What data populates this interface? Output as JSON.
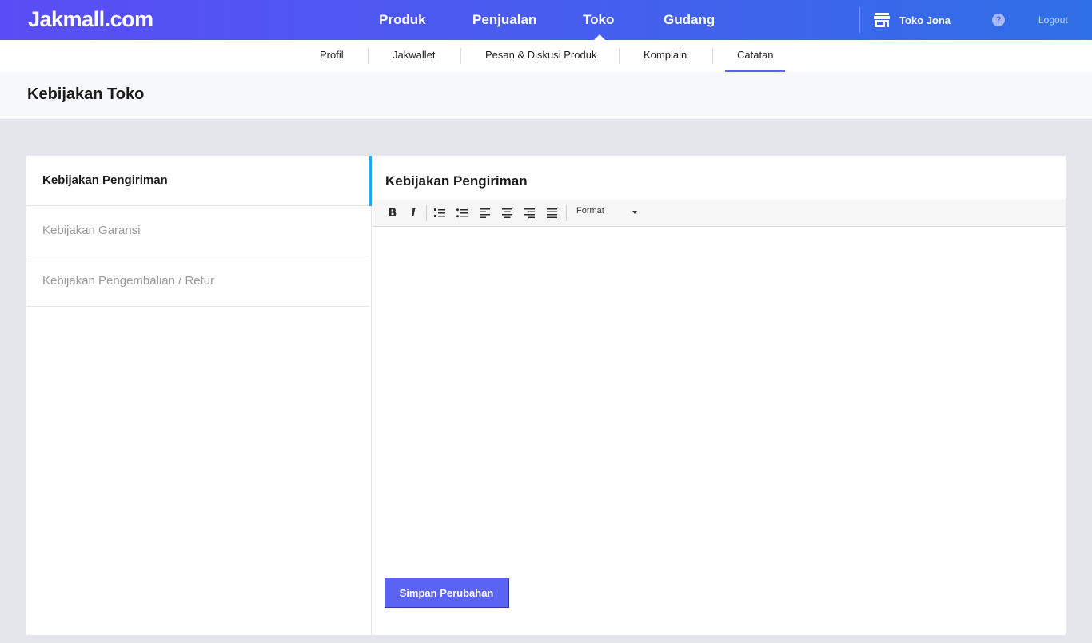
{
  "app": {
    "logo": "Jakmall.com"
  },
  "topnav": {
    "items": [
      {
        "label": "Produk"
      },
      {
        "label": "Penjualan"
      },
      {
        "label": "Toko",
        "active": true
      },
      {
        "label": "Gudang"
      }
    ],
    "store_name": "Toko Jona",
    "help": "?",
    "logout": "Logout"
  },
  "subnav": {
    "items": [
      {
        "label": "Profil"
      },
      {
        "label": "Jakwallet"
      },
      {
        "label": "Pesan & Diskusi Produk"
      },
      {
        "label": "Komplain"
      },
      {
        "label": "Catatan",
        "active": true
      }
    ]
  },
  "page": {
    "title": "Kebijakan Toko"
  },
  "sidebar": {
    "items": [
      {
        "label": "Kebijakan Pengiriman",
        "active": true
      },
      {
        "label": "Kebijakan Garansi"
      },
      {
        "label": "Kebijakan Pengembalian / Retur"
      }
    ]
  },
  "editor": {
    "title": "Kebijakan Pengiriman",
    "toolbar": {
      "bold": "B",
      "italic": "I",
      "format_label": "Format"
    },
    "content": "",
    "save_label": "Simpan Perubahan"
  },
  "colors": {
    "accent": "#5b63f2",
    "active_indicator": "#1eaaf1",
    "topbar_start": "#5a4df5",
    "topbar_end": "#2f6fe6"
  }
}
